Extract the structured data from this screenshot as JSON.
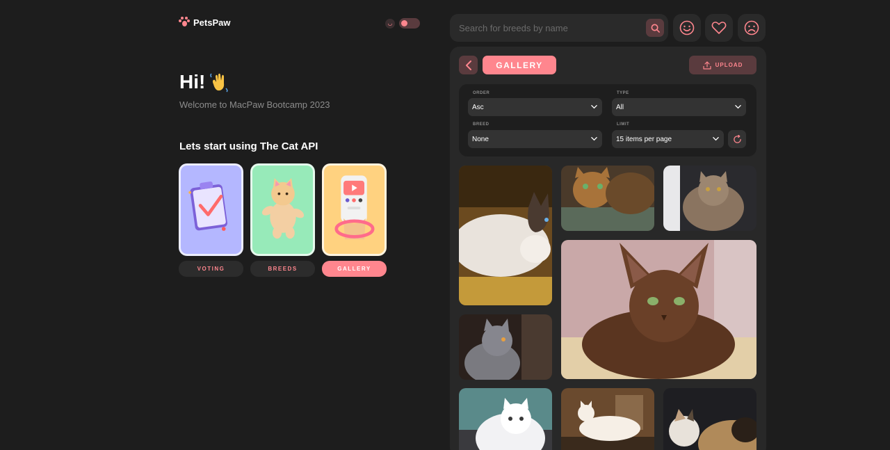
{
  "brand": {
    "name": "PetsPaw"
  },
  "greeting": {
    "title": "Hi!",
    "subtitle": "Welcome to MacPaw Bootcamp 2023",
    "cta": "Lets start using The Cat API"
  },
  "nav": [
    {
      "label": "VOTING"
    },
    {
      "label": "BREEDS"
    },
    {
      "label": "GALLERY"
    }
  ],
  "search": {
    "placeholder": "Search for breeds by name"
  },
  "panel": {
    "title": "GALLERY",
    "upload_label": "UPLOAD",
    "filters": {
      "order": {
        "label": "ORDER",
        "value": "Asc"
      },
      "type": {
        "label": "TYPE",
        "value": "All"
      },
      "breed": {
        "label": "BREED",
        "value": "None"
      },
      "limit": {
        "label": "LIMIT",
        "value": "15 items per page"
      }
    }
  },
  "colors": {
    "accent": "#ff868e",
    "background": "#1d1d1d",
    "panel": "#282828",
    "accent_dim": "#5a3b3e"
  }
}
